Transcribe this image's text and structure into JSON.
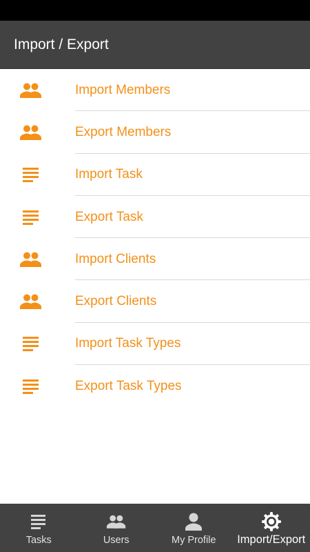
{
  "app_bar": {
    "title": "Import / Export"
  },
  "colors": {
    "accent": "#f39019",
    "toolbar": "#424242",
    "status_bar": "#000000"
  },
  "menu": [
    {
      "label": "Import Members",
      "icon": "group-icon"
    },
    {
      "label": "Export Members",
      "icon": "group-icon"
    },
    {
      "label": "Import Task",
      "icon": "notes-icon"
    },
    {
      "label": "Export Task",
      "icon": "notes-icon"
    },
    {
      "label": "Import Clients",
      "icon": "group-icon"
    },
    {
      "label": "Export Clients",
      "icon": "group-icon"
    },
    {
      "label": "Import Task Types",
      "icon": "notes-icon"
    },
    {
      "label": "Export Task Types",
      "icon": "notes-icon"
    }
  ],
  "bottom_nav": {
    "items": [
      {
        "label": "Tasks",
        "icon": "notes-icon"
      },
      {
        "label": "Users",
        "icon": "group-icon"
      },
      {
        "label": "My Profile",
        "icon": "person-icon"
      },
      {
        "label": "Import/Export",
        "icon": "gear-icon"
      }
    ],
    "active": "Import/Export"
  }
}
